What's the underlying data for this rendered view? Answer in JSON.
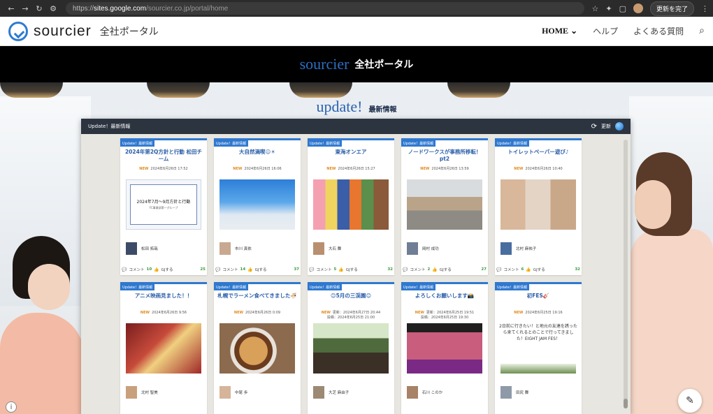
{
  "browser": {
    "url_prefix": "https://",
    "url_host": "sites.google.com",
    "url_path": "/sourcier.co.jp/portal/home",
    "update_button": "更新を完了"
  },
  "header": {
    "brand": "sourcier",
    "subtitle": "全社ポータル",
    "menu": {
      "home": "HOME",
      "help": "ヘルプ",
      "faq": "よくある質問"
    }
  },
  "banner": {
    "brand": "sourcier",
    "subtitle": "全社ポータル"
  },
  "update_section": {
    "title": "update!",
    "subtitle": "最新情報"
  },
  "panel": {
    "title": "Update！最新情報",
    "refresh_label": "更新"
  },
  "cards": [
    {
      "tag": "Update！最新情報",
      "title": "2024年第2Q方針と行動 松田チーム",
      "new": "NEW",
      "date": "2024年6月26日 17:52",
      "doc_title": "2024年7月〜9月方針と行動",
      "doc_sub": "FC事業部第一グループ",
      "author": "松田 拓哉",
      "comment_label": "コメント",
      "comments": "10",
      "like_label": "GJする",
      "likes": "25"
    },
    {
      "tag": "Update！最新情報",
      "title": "大自然満喫☺☀",
      "new": "NEW",
      "date": "2024年6月26日 16:06",
      "author": "市川 真依",
      "comment_label": "コメント",
      "comments": "14",
      "like_label": "GJする",
      "likes": "37"
    },
    {
      "tag": "Update！最新情報",
      "title": "東海オンエア",
      "new": "NEW",
      "date": "2024年6月26日 15:27",
      "author": "大石 舞",
      "comment_label": "コメント",
      "comments": "5",
      "like_label": "GJする",
      "likes": "32"
    },
    {
      "tag": "Update！最新情報",
      "title": "ノードワークスが事務所移転！pt2",
      "new": "NEW",
      "date": "2024年6月26日 13:59",
      "author": "岡村 成功",
      "comment_label": "コメント",
      "comments": "2",
      "like_label": "GJする",
      "likes": "27"
    },
    {
      "tag": "Update！最新情報",
      "title": "トイレットペーパー遊び♪",
      "new": "NEW",
      "date": "2024年6月26日 10:40",
      "author": "北村 麻祐子",
      "comment_label": "コメント",
      "comments": "6",
      "like_label": "GJする",
      "likes": "32"
    },
    {
      "tag": "Update！最新情報",
      "title": "アニメ映画見ました！！",
      "new": "NEW",
      "date": "2024年6月26日 9:56",
      "author": "北村 智美"
    },
    {
      "tag": "Update！最新情報",
      "title": "札幌でラーメン食べてきました🍜",
      "new": "NEW",
      "date": "2024年6月26日 0:09",
      "author": "中尾 歩"
    },
    {
      "tag": "Update！最新情報",
      "title": "😊5月の三渓園😊",
      "new": "NEW",
      "date": "更新：2024年6月27日 20:44",
      "date2": "投稿：2024年6月25日 21:00",
      "author": "大芝 麻由子"
    },
    {
      "tag": "Update！最新情報",
      "title": "よろしくお願いします📸",
      "new": "NEW",
      "date": "更新：2024年6月25日 19:51",
      "date2": "投稿：2024年6月25日 19:30",
      "author": "石川 このか"
    },
    {
      "tag": "Update！最新情報",
      "title": "初FES🎸",
      "new": "NEW",
      "date": "2024年6月25日 19:16",
      "body": "2日前に行きたい！と地元の友達を誘ったら来てくれるとのことで行ってきました！EIGHT JAM FES！",
      "author": "田尻 舞"
    }
  ]
}
